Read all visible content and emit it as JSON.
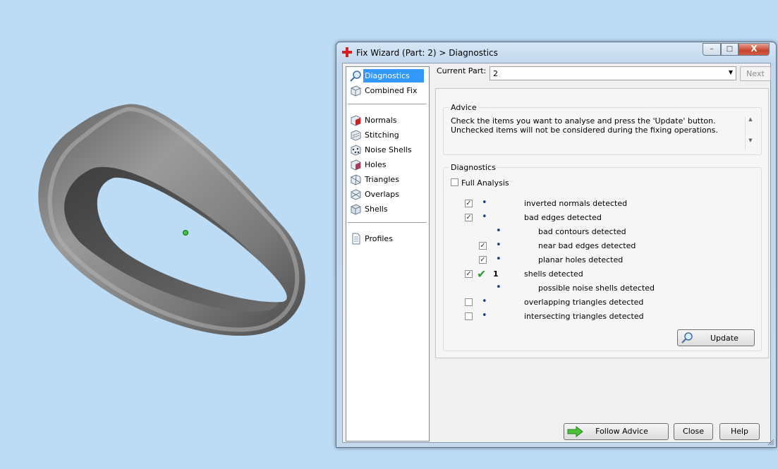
{
  "window": {
    "title": "Fix Wizard (Part: 2) > Diagnostics",
    "controls": {
      "minimize": "–",
      "maximize": "□",
      "close": "X"
    }
  },
  "nav": {
    "items": [
      {
        "label": "Diagnostics",
        "icon": "magnifier-icon",
        "selected": true
      },
      {
        "label": "Combined Fix",
        "icon": "cube-icon"
      },
      {
        "label": "Normals",
        "icon": "normals-cube-icon"
      },
      {
        "label": "Stitching",
        "icon": "stitching-icon"
      },
      {
        "label": "Noise Shells",
        "icon": "noise-shells-icon"
      },
      {
        "label": "Holes",
        "icon": "holes-icon"
      },
      {
        "label": "Triangles",
        "icon": "triangles-icon"
      },
      {
        "label": "Overlaps",
        "icon": "overlaps-icon"
      },
      {
        "label": "Shells",
        "icon": "shells-icon"
      },
      {
        "label": "Profiles",
        "icon": "document-icon"
      }
    ]
  },
  "header": {
    "current_part_label": "Current Part:",
    "current_part_value": "2",
    "next_label": "Next"
  },
  "advice": {
    "title": "Advice",
    "text": "Check the items you want to analyse and press the 'Update' button. Unchecked items will not be considered during the fixing operations."
  },
  "diagnostics": {
    "title": "Diagnostics",
    "full_analysis_label": "Full Analysis",
    "full_analysis_checked": false,
    "rows": [
      {
        "label": "inverted normals detected",
        "checked": true,
        "level": 0,
        "status": "•"
      },
      {
        "label": "bad edges detected",
        "checked": true,
        "level": 0,
        "status": "•"
      },
      {
        "label": "bad contours detected",
        "checked": null,
        "level": 1,
        "status": "•"
      },
      {
        "label": "near bad edges detected",
        "checked": true,
        "level": 1,
        "status": "•"
      },
      {
        "label": "planar holes detected",
        "checked": true,
        "level": 1,
        "status": "•"
      },
      {
        "label": "shells detected",
        "checked": true,
        "level": 0,
        "status": "✔",
        "count": "1"
      },
      {
        "label": "possible noise shells detected",
        "checked": null,
        "level": 1,
        "status": "•"
      },
      {
        "label": "overlapping triangles detected",
        "checked": false,
        "level": 0,
        "status": "•"
      },
      {
        "label": "intersecting triangles detected",
        "checked": false,
        "level": 0,
        "status": "•"
      }
    ],
    "update_label": "Update"
  },
  "footer": {
    "follow_advice_label": "Follow Advice",
    "close_label": "Close",
    "help_label": "Help"
  },
  "colors": {
    "background": "#bcdcf6",
    "selection": "#3399ff",
    "check_green": "#2f9a2f",
    "model_gray": "#8a8a8a"
  }
}
